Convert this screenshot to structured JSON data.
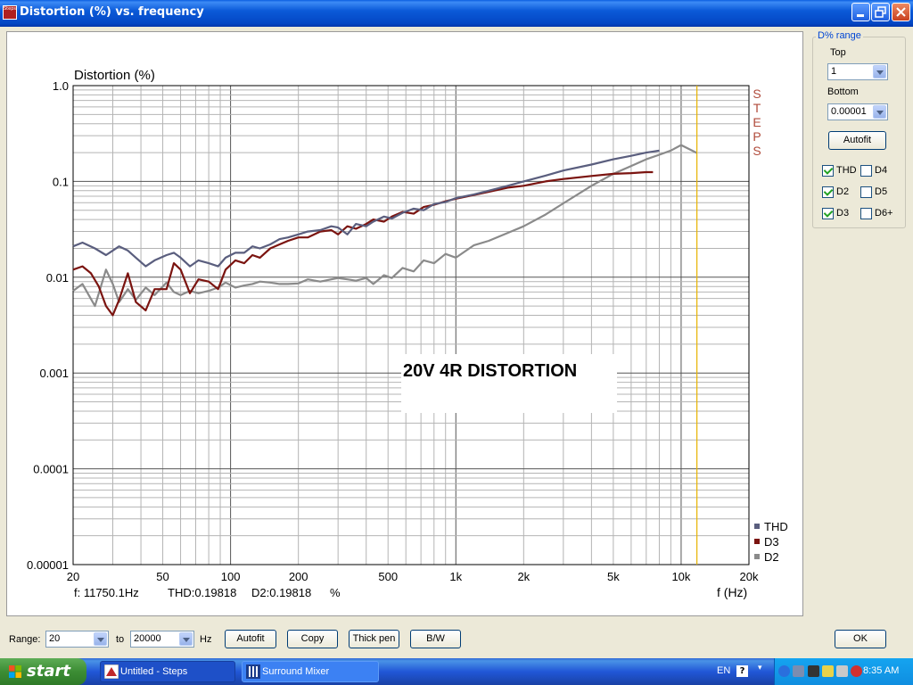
{
  "window": {
    "title": "Distortion (%) vs. frequency",
    "app_icon_text": "Steps"
  },
  "chart_data": {
    "type": "line",
    "title": "",
    "ylabel": "Distortion (%)",
    "xlabel": "f (Hz)",
    "x_scale": "log",
    "y_scale": "log",
    "xlim": [
      20,
      20000
    ],
    "ylim": [
      1e-05,
      1.0
    ],
    "x_ticks": [
      20,
      50,
      100,
      200,
      500,
      1000,
      2000,
      5000,
      10000,
      20000
    ],
    "x_tick_labels": [
      "20",
      "50",
      "100",
      "200",
      "500",
      "1k",
      "2k",
      "5k",
      "10k",
      "20k"
    ],
    "y_ticks": [
      1e-05,
      0.0001,
      0.001,
      0.01,
      0.1,
      1.0
    ],
    "y_tick_labels": [
      "0.00001",
      "0.0001",
      "0.001",
      "0.01",
      "0.1",
      "1.0"
    ],
    "grid": true,
    "brand": "STEPS",
    "annotation": "20V 4R DISTORTION",
    "cursor_frequency": 11750.1,
    "readout": {
      "freq": "f: 11750.1Hz",
      "thd": "THD:0.19818",
      "d2": "D2:0.19818",
      "unit": "%"
    },
    "legend_position": "bottom-right",
    "series": [
      {
        "name": "THD",
        "color": "#5a5e7e",
        "x": [
          20,
          22,
          25,
          28,
          30,
          32,
          35,
          38,
          42,
          46,
          52,
          56,
          60,
          66,
          72,
          80,
          88,
          95,
          105,
          115,
          125,
          135,
          150,
          165,
          180,
          200,
          220,
          250,
          280,
          300,
          330,
          360,
          400,
          430,
          480,
          520,
          580,
          650,
          720,
          800,
          900,
          1000,
          1200,
          1400,
          1700,
          2000,
          2500,
          3000,
          4000,
          5000,
          6000,
          7000,
          7500,
          8000
        ],
        "y": [
          0.021,
          0.023,
          0.02,
          0.017,
          0.019,
          0.021,
          0.019,
          0.016,
          0.013,
          0.015,
          0.017,
          0.018,
          0.016,
          0.013,
          0.015,
          0.014,
          0.013,
          0.016,
          0.018,
          0.018,
          0.021,
          0.02,
          0.022,
          0.025,
          0.026,
          0.028,
          0.03,
          0.031,
          0.034,
          0.033,
          0.028,
          0.036,
          0.034,
          0.038,
          0.043,
          0.041,
          0.047,
          0.052,
          0.05,
          0.058,
          0.061,
          0.067,
          0.073,
          0.08,
          0.09,
          0.1,
          0.115,
          0.13,
          0.15,
          0.17,
          0.185,
          0.2,
          0.205,
          0.21
        ]
      },
      {
        "name": "D3",
        "color": "#7b1410",
        "x": [
          20,
          22,
          24,
          26,
          28,
          30,
          32,
          35,
          38,
          42,
          46,
          52,
          56,
          60,
          66,
          72,
          80,
          88,
          95,
          105,
          115,
          125,
          135,
          150,
          165,
          180,
          200,
          220,
          250,
          280,
          300,
          330,
          360,
          400,
          430,
          480,
          520,
          580,
          650,
          720,
          800,
          900,
          1000,
          1200,
          1400,
          1700,
          2000,
          2500,
          3000,
          4000,
          5000,
          6000,
          7000,
          7500
        ],
        "y": [
          0.012,
          0.013,
          0.011,
          0.008,
          0.005,
          0.004,
          0.0058,
          0.011,
          0.0055,
          0.0045,
          0.0075,
          0.0075,
          0.014,
          0.012,
          0.0068,
          0.0095,
          0.009,
          0.0075,
          0.012,
          0.015,
          0.014,
          0.017,
          0.016,
          0.02,
          0.022,
          0.024,
          0.026,
          0.026,
          0.03,
          0.031,
          0.028,
          0.034,
          0.032,
          0.036,
          0.04,
          0.038,
          0.043,
          0.048,
          0.046,
          0.054,
          0.057,
          0.062,
          0.066,
          0.072,
          0.078,
          0.086,
          0.09,
          0.1,
          0.106,
          0.114,
          0.12,
          0.122,
          0.125,
          0.125
        ]
      },
      {
        "name": "D2",
        "color": "#8a8a8a",
        "x": [
          20,
          22,
          25,
          28,
          30,
          32,
          35,
          38,
          42,
          46,
          52,
          56,
          60,
          66,
          72,
          80,
          88,
          95,
          105,
          115,
          125,
          135,
          150,
          165,
          180,
          200,
          220,
          250,
          280,
          300,
          330,
          360,
          400,
          430,
          480,
          520,
          580,
          650,
          720,
          800,
          900,
          1000,
          1200,
          1400,
          1700,
          2000,
          2500,
          3000,
          4000,
          5000,
          6000,
          7000,
          8000,
          9000,
          10000,
          11750
        ],
        "y": [
          0.0072,
          0.0085,
          0.005,
          0.012,
          0.0085,
          0.0055,
          0.0075,
          0.0058,
          0.0078,
          0.0065,
          0.0088,
          0.007,
          0.0065,
          0.0072,
          0.0068,
          0.0072,
          0.0078,
          0.0088,
          0.0078,
          0.0082,
          0.0085,
          0.009,
          0.0088,
          0.0085,
          0.0085,
          0.0086,
          0.0095,
          0.009,
          0.0095,
          0.0098,
          0.0095,
          0.0092,
          0.0098,
          0.0085,
          0.0105,
          0.0098,
          0.0125,
          0.0115,
          0.015,
          0.014,
          0.0175,
          0.016,
          0.0215,
          0.024,
          0.029,
          0.034,
          0.045,
          0.059,
          0.09,
          0.12,
          0.145,
          0.17,
          0.19,
          0.21,
          0.24,
          0.19818
        ]
      }
    ]
  },
  "range_panel": {
    "title": "D% range",
    "top_label": "Top",
    "top_value": "1",
    "bottom_label": "Bottom",
    "bottom_value": "0.00001",
    "autofit_label": "Autofit",
    "checkboxes": [
      {
        "label": "THD",
        "checked": true
      },
      {
        "label": "D4",
        "checked": false
      },
      {
        "label": "D2",
        "checked": true
      },
      {
        "label": "D5",
        "checked": false
      },
      {
        "label": "D3",
        "checked": true
      },
      {
        "label": "D6+",
        "checked": false
      }
    ]
  },
  "bottom_bar": {
    "range_label": "Range:",
    "range_from": "20",
    "to_label": "to",
    "range_to": "20000",
    "unit_label": "Hz",
    "autofit_label": "Autofit",
    "copy_label": "Copy",
    "thick_pen_label": "Thick pen",
    "bw_label": "B/W",
    "ok_label": "OK"
  },
  "taskbar": {
    "start_label": "start",
    "items": [
      {
        "label": "Untitled - Steps",
        "active": true
      },
      {
        "label": "Surround Mixer",
        "active": false
      }
    ],
    "lang": "EN",
    "clock": "8:35 AM"
  }
}
